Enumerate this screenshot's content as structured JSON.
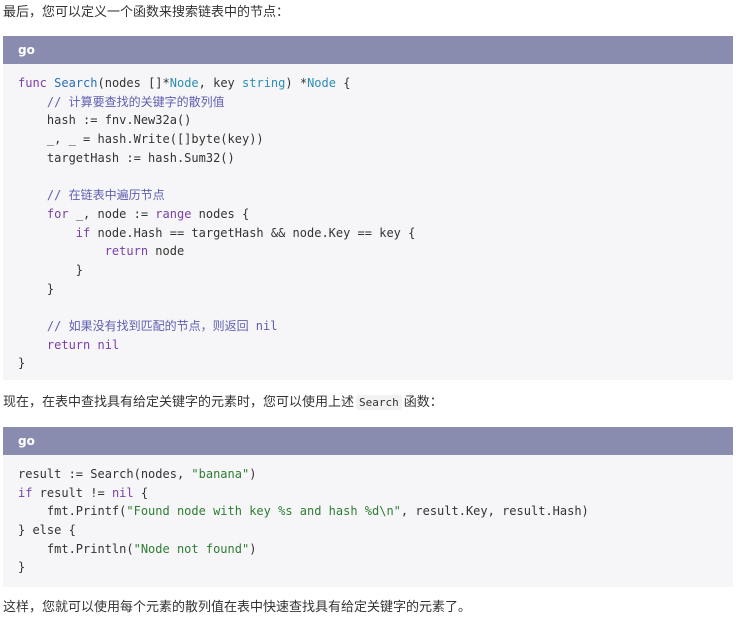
{
  "intro_text": "最后，您可以定义一个函数来搜索链表中的节点：",
  "code_block_1": {
    "language": "go",
    "lines": {
      "l1": {
        "a": "func",
        "b": " ",
        "c": "Search",
        "d": "(nodes []*",
        "e": "Node",
        "f": ", key ",
        "g": "string",
        "h": ") *",
        "i": "Node",
        "j": " {"
      },
      "l2": "    // 计算要查找的关键字的散列值",
      "l3": "    hash := fnv.New32a()",
      "l4": "    _, _ = hash.Write([]byte(key))",
      "l5": "    targetHash := hash.Sum32()",
      "l6": "",
      "l7": "    // 在链表中遍历节点",
      "l8": {
        "a": "    ",
        "b": "for",
        "c": " _, node := ",
        "d": "range",
        "e": " nodes {"
      },
      "l9": {
        "a": "        ",
        "b": "if",
        "c": " node.Hash == targetHash && node.Key == key {"
      },
      "l10": {
        "a": "            ",
        "b": "return",
        "c": " node"
      },
      "l11": "        }",
      "l12": "    }",
      "l13": "",
      "l14": "    // 如果没有找到匹配的节点，则返回 nil",
      "l15": {
        "a": "    ",
        "b": "return",
        "c": " ",
        "d": "nil"
      },
      "l16": "}"
    }
  },
  "middle_text": {
    "before": "现在，在表中查找具有给定关键字的元素时，您可以使用上述",
    "code": "Search",
    "after": "函数："
  },
  "code_block_2": {
    "language": "go",
    "lines": {
      "l1": {
        "a": "result := Search(nodes, ",
        "b": "\"banana\"",
        "c": ")"
      },
      "l2": {
        "a": "if",
        "b": " result != ",
        "c": "nil",
        "d": " {"
      },
      "l3": {
        "a": "    fmt.Printf(",
        "b": "\"Found node with key %s and hash %d\\n\"",
        "c": ", result.Key, result.Hash)"
      },
      "l4": "} else {",
      "l5": {
        "a": "    fmt.Println(",
        "b": "\"Node not found\"",
        "c": ")"
      },
      "l6": "}"
    }
  },
  "outro_text": "这样，您就可以使用每个元素的散列值在表中快速查找具有给定关键字的元素了。",
  "colors": {
    "header_bar": "#8a8caf",
    "code_bg": "#f6f6f8",
    "keyword": "#7a3ea8",
    "function": "#2b6fb5",
    "comment": "#5f5fb0",
    "string": "#2e7d32"
  }
}
